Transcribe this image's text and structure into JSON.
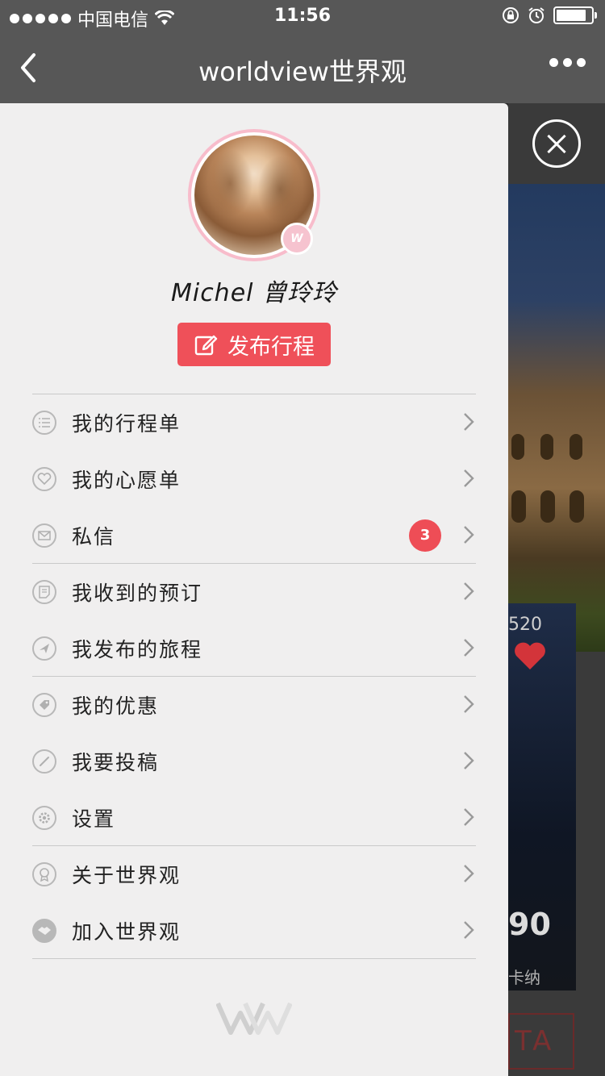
{
  "status_bar": {
    "carrier": "中国电信",
    "time": "11:56"
  },
  "nav": {
    "title": "worldview世界观"
  },
  "profile": {
    "name": "Michel 曾玲玲",
    "badge_letter": "W",
    "publish_label": "发布行程"
  },
  "menu": [
    {
      "label": "我的行程单",
      "icon": "list-icon"
    },
    {
      "label": "我的心愿单",
      "icon": "heart-icon"
    },
    {
      "label": "私信",
      "icon": "mail-icon",
      "badge": "3"
    },
    {
      "label": "我收到的预订",
      "icon": "receipt-icon"
    },
    {
      "label": "我发布的旅程",
      "icon": "plane-icon"
    },
    {
      "label": "我的优惠",
      "icon": "tag-icon"
    },
    {
      "label": "我要投稿",
      "icon": "pen-icon"
    },
    {
      "label": "设置",
      "icon": "gear-icon"
    },
    {
      "label": "关于世界观",
      "icon": "medal-icon"
    },
    {
      "label": "加入世界观",
      "icon": "handshake-icon"
    }
  ],
  "background_page": {
    "likes": "520",
    "price": "90",
    "location": "卡纳",
    "tag": "TA"
  },
  "colors": {
    "accent": "#ef5059",
    "drawer_bg": "#f0efef",
    "nav_bg": "#575757"
  }
}
